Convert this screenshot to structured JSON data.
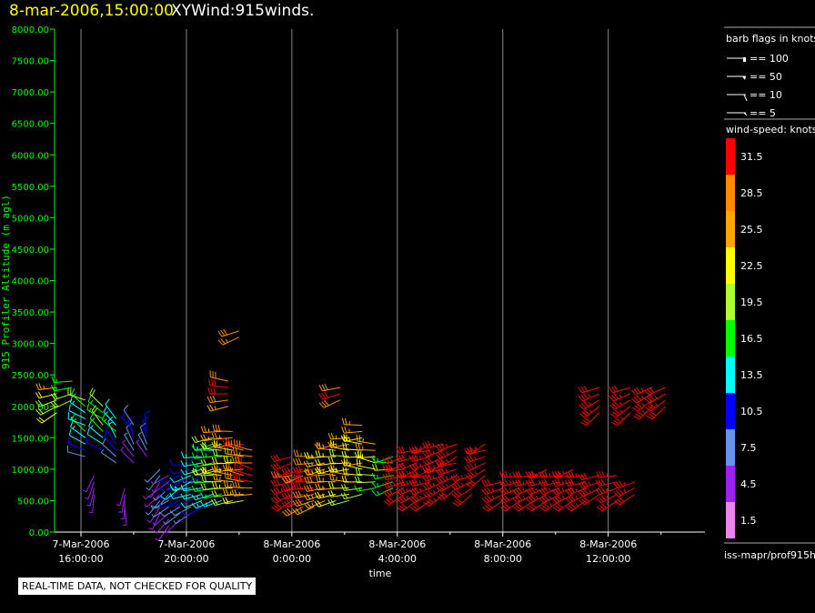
{
  "header": {
    "date": "8-mar-2006,15:00:00",
    "name": "XYWind:915winds."
  },
  "notice": "REAL-TIME DATA, NOT CHECKED FOR QUALITY",
  "source": "iss-mapr/prof915h",
  "chart_data": {
    "type": "wind-barb",
    "xlabel": "time",
    "ylabel": "915 Profiler Altitude (m agl)",
    "xlim": [
      "2006-03-07T15:00",
      "2006-03-08T15:40"
    ],
    "ylim": [
      0,
      8000
    ],
    "yticks": [
      "0.00",
      "500.00",
      "1000.00",
      "1500.00",
      "2000.00",
      "2500.00",
      "3000.00",
      "3500.00",
      "4000.00",
      "4500.00",
      "5000.00",
      "5500.00",
      "6000.00",
      "6500.00",
      "7000.00",
      "7500.00",
      "8000.00"
    ],
    "xticks": [
      {
        "t": "2006-03-07T16:00",
        "l1": "7-Mar-2006",
        "l2": "16:00:00"
      },
      {
        "t": "2006-03-07T20:00",
        "l1": "7-Mar-2006",
        "l2": "20:00:00"
      },
      {
        "t": "2006-03-08T00:00",
        "l1": "8-Mar-2006",
        "l2": "0:00:00"
      },
      {
        "t": "2006-03-08T04:00",
        "l1": "8-Mar-2006",
        "l2": "4:00:00"
      },
      {
        "t": "2006-03-08T08:00",
        "l1": "8-Mar-2006",
        "l2": "8:00:00"
      },
      {
        "t": "2006-03-08T12:00",
        "l1": "8-Mar-2006",
        "l2": "12:00:00"
      }
    ],
    "grid": "vertical",
    "barb_legend": {
      "title": "barb flags in knots",
      "items": [
        "== 100",
        "== 50",
        "== 10",
        "== 5"
      ]
    },
    "colorbar": {
      "title": "wind-speed: knots",
      "levels": [
        "31.5",
        "28.5",
        "25.5",
        "22.5",
        "19.5",
        "16.5",
        "13.5",
        "10.5",
        "7.5",
        "4.5",
        "1.5"
      ],
      "colors": [
        "#ff0000",
        "#ff8c00",
        "#ffa500",
        "#ffff00",
        "#adff2f",
        "#00ff00",
        "#00ffff",
        "#0000ff",
        "#6495ed",
        "#a020f0",
        "#ee82ee"
      ]
    },
    "gate_spacing_m": 100,
    "profiles": [
      {
        "t": "2006-03-07T15:05",
        "alt0": 1900,
        "spd": [
          22,
          20,
          18,
          21,
          24
        ],
        "dir": 250
      },
      {
        "t": "2006-03-07T15:40",
        "alt0": 2100,
        "spd": [
          20,
          18,
          16,
          17
        ],
        "dir": 260
      },
      {
        "t": "2006-03-07T16:10",
        "alt0": 1200,
        "spd": [
          8,
          10,
          12,
          14,
          15,
          13,
          12,
          14,
          16,
          18
        ],
        "dir": 300
      },
      {
        "t": "2006-03-07T16:30",
        "alt0": 600,
        "spd": [
          4,
          5,
          5,
          4
        ],
        "dir": 200
      },
      {
        "t": "2006-03-07T16:50",
        "alt0": 1300,
        "spd": [
          10,
          12,
          14,
          16,
          18,
          17,
          15,
          18
        ],
        "dir": 310
      },
      {
        "t": "2006-03-07T17:20",
        "alt0": 1100,
        "spd": [
          6,
          8,
          9,
          11,
          13,
          15,
          14,
          12
        ],
        "dir": 320
      },
      {
        "t": "2006-03-07T17:40",
        "alt0": 400,
        "spd": [
          4,
          5,
          4,
          5
        ],
        "dir": 190
      },
      {
        "t": "2006-03-07T18:00",
        "alt0": 1100,
        "spd": [
          4,
          5,
          6,
          8,
          10,
          9,
          8
        ],
        "dir": 330
      },
      {
        "t": "2006-03-07T18:30",
        "alt0": 1200,
        "spd": [
          5,
          6,
          8,
          9,
          10
        ],
        "dir": 340
      },
      {
        "t": "2006-03-07T19:00",
        "alt0": 300,
        "spd": [
          4,
          5,
          6,
          5,
          4,
          5,
          6,
          7
        ],
        "dir": 220
      },
      {
        "t": "2006-03-07T19:20",
        "alt0": 100,
        "spd": [
          3,
          4,
          5,
          6,
          7,
          8,
          6,
          5,
          4
        ],
        "dir": 230
      },
      {
        "t": "2006-03-07T19:45",
        "alt0": 200,
        "spd": [
          5,
          6,
          8,
          9,
          10,
          12,
          11,
          9
        ],
        "dir": 240
      },
      {
        "t": "2006-03-07T20:10",
        "alt0": 300,
        "spd": [
          6,
          8,
          10,
          12,
          13,
          14,
          12,
          10,
          11
        ],
        "dir": 250
      },
      {
        "t": "2006-03-07T20:35",
        "alt0": 400,
        "spd": [
          10,
          12,
          13,
          14,
          12,
          11,
          13,
          14,
          13
        ],
        "dir": 255
      },
      {
        "t": "2006-03-07T21:00",
        "alt0": 500,
        "spd": [
          13,
          14,
          16,
          17,
          18,
          19,
          17,
          15,
          14,
          16,
          18
        ],
        "dir": 260
      },
      {
        "t": "2006-03-07T21:20",
        "alt0": 500,
        "spd": [
          14,
          16,
          18,
          20,
          22,
          21,
          19,
          17,
          18,
          20,
          24,
          26
        ],
        "dir": 265
      },
      {
        "t": "2006-03-07T21:35",
        "alt0": 2000,
        "spd": [
          26,
          28,
          30,
          32,
          28
        ],
        "dir": 270
      },
      {
        "t": "2006-03-07T21:45",
        "alt0": 500,
        "spd": [
          18,
          20,
          23,
          25,
          26,
          24,
          22,
          20,
          21,
          24,
          27,
          28
        ],
        "dir": 270
      },
      {
        "t": "2006-03-07T22:00",
        "alt0": 3100,
        "spd": [
          27,
          29
        ],
        "dir": 260
      },
      {
        "t": "2006-03-07T22:10",
        "alt0": 500,
        "spd": [
          22,
          24,
          26,
          28,
          27,
          25,
          23,
          26,
          28,
          30
        ],
        "dir": 275
      },
      {
        "t": "2006-03-07T22:30",
        "alt0": 600,
        "spd": [
          26,
          28,
          30,
          32,
          30,
          28,
          27,
          29
        ],
        "dir": 280
      },
      {
        "t": "2006-03-08T00:00",
        "alt0": 500,
        "spd": [
          30,
          32,
          33,
          31,
          29,
          30,
          32,
          31
        ],
        "dir": 250
      },
      {
        "t": "2006-03-08T00:25",
        "alt0": 400,
        "spd": [
          28,
          30,
          32,
          33,
          31,
          29,
          30
        ],
        "dir": 255
      },
      {
        "t": "2006-03-08T00:50",
        "alt0": 400,
        "spd": [
          26,
          28,
          29,
          30,
          31,
          32,
          30,
          28,
          27
        ],
        "dir": 260
      },
      {
        "t": "2006-03-08T01:15",
        "alt0": 500,
        "spd": [
          24,
          26,
          28,
          29,
          27,
          26,
          24,
          23
        ],
        "dir": 260
      },
      {
        "t": "2006-03-08T01:40",
        "alt0": 500,
        "spd": [
          22,
          23,
          25,
          26,
          24,
          22,
          21,
          23,
          25,
          27
        ],
        "dir": 265
      },
      {
        "t": "2006-03-08T01:50",
        "alt0": 2100,
        "spd": [
          28,
          30,
          29
        ],
        "dir": 260
      },
      {
        "t": "2006-03-08T02:10",
        "alt0": 500,
        "spd": [
          20,
          21,
          22,
          24,
          25,
          23,
          21,
          20,
          22,
          24,
          26
        ],
        "dir": 270
      },
      {
        "t": "2006-03-08T02:40",
        "alt0": 600,
        "spd": [
          18,
          20,
          21,
          22,
          23,
          24,
          22,
          21,
          22,
          23,
          24,
          25
        ],
        "dir": 270
      },
      {
        "t": "2006-03-08T03:10",
        "alt0": 700,
        "spd": [
          17,
          19,
          20,
          22,
          21,
          23,
          24,
          25
        ],
        "dir": 275
      },
      {
        "t": "2006-03-08T03:50",
        "alt0": 700,
        "spd": [
          15,
          16,
          17,
          18,
          16,
          15
        ],
        "dir": 260
      },
      {
        "t": "2006-03-08T04:15",
        "alt0": 600,
        "spd": [
          30,
          32,
          33,
          34,
          32,
          31,
          30
        ],
        "dir": 250
      },
      {
        "t": "2006-03-08T04:45",
        "alt0": 500,
        "spd": [
          31,
          33,
          35,
          34,
          32,
          33,
          31,
          30,
          32
        ],
        "dir": 250
      },
      {
        "t": "2006-03-08T05:15",
        "alt0": 500,
        "spd": [
          32,
          34,
          35,
          33,
          32,
          31,
          33,
          34,
          35,
          33
        ],
        "dir": 250
      },
      {
        "t": "2006-03-08T05:45",
        "alt0": 600,
        "spd": [
          33,
          34,
          35,
          36,
          34,
          33,
          32,
          34,
          33
        ],
        "dir": 245
      },
      {
        "t": "2006-03-08T06:15",
        "alt0": 700,
        "spd": [
          32,
          33,
          34,
          33,
          32,
          34,
          33,
          35
        ],
        "dir": 245
      },
      {
        "t": "2006-03-08T06:50",
        "alt0": 600,
        "spd": [
          31,
          32,
          34,
          33
        ],
        "dir": 245
      },
      {
        "t": "2006-03-08T07:20",
        "alt0": 900,
        "spd": [
          32,
          33,
          34,
          35,
          33,
          34
        ],
        "dir": 245
      },
      {
        "t": "2006-03-08T08:00",
        "alt0": 500,
        "spd": [
          32,
          33,
          34,
          32
        ],
        "dir": 250
      },
      {
        "t": "2006-03-08T08:40",
        "alt0": 500,
        "spd": [
          31,
          32,
          33,
          34,
          33
        ],
        "dir": 250
      },
      {
        "t": "2006-03-08T09:10",
        "alt0": 500,
        "spd": [
          32,
          33,
          34,
          33,
          32
        ],
        "dir": 250
      },
      {
        "t": "2006-03-08T09:40",
        "alt0": 500,
        "spd": [
          32,
          34,
          33,
          32,
          33,
          32
        ],
        "dir": 250
      },
      {
        "t": "2006-03-08T10:10",
        "alt0": 500,
        "spd": [
          33,
          34,
          33,
          32,
          34
        ],
        "dir": 250
      },
      {
        "t": "2006-03-08T10:40",
        "alt0": 500,
        "spd": [
          32,
          33,
          34,
          33,
          32,
          33
        ],
        "dir": 250
      },
      {
        "t": "2006-03-08T11:10",
        "alt0": 500,
        "spd": [
          33,
          34,
          33,
          32,
          33
        ],
        "dir": 250
      },
      {
        "t": "2006-03-08T11:40",
        "alt0": 600,
        "spd": [
          32,
          33,
          34,
          32
        ],
        "dir": 250
      },
      {
        "t": "2006-03-08T11:40",
        "alt0": 1900,
        "spd": [
          32,
          33,
          34,
          33,
          32
        ],
        "dir": 240
      },
      {
        "t": "2006-03-08T12:20",
        "alt0": 500,
        "spd": [
          33,
          34,
          33,
          32,
          33
        ],
        "dir": 250
      },
      {
        "t": "2006-03-08T12:50",
        "alt0": 1900,
        "spd": [
          33,
          34,
          35,
          33,
          32
        ],
        "dir": 240
      },
      {
        "t": "2006-03-08T13:00",
        "alt0": 600,
        "spd": [
          32,
          33,
          34
        ],
        "dir": 250
      },
      {
        "t": "2006-03-08T13:40",
        "alt0": 2000,
        "spd": [
          33,
          34,
          35,
          33
        ],
        "dir": 240
      },
      {
        "t": "2006-03-08T14:10",
        "alt0": 2000,
        "spd": [
          32,
          33,
          34,
          32
        ],
        "dir": 240
      }
    ]
  }
}
